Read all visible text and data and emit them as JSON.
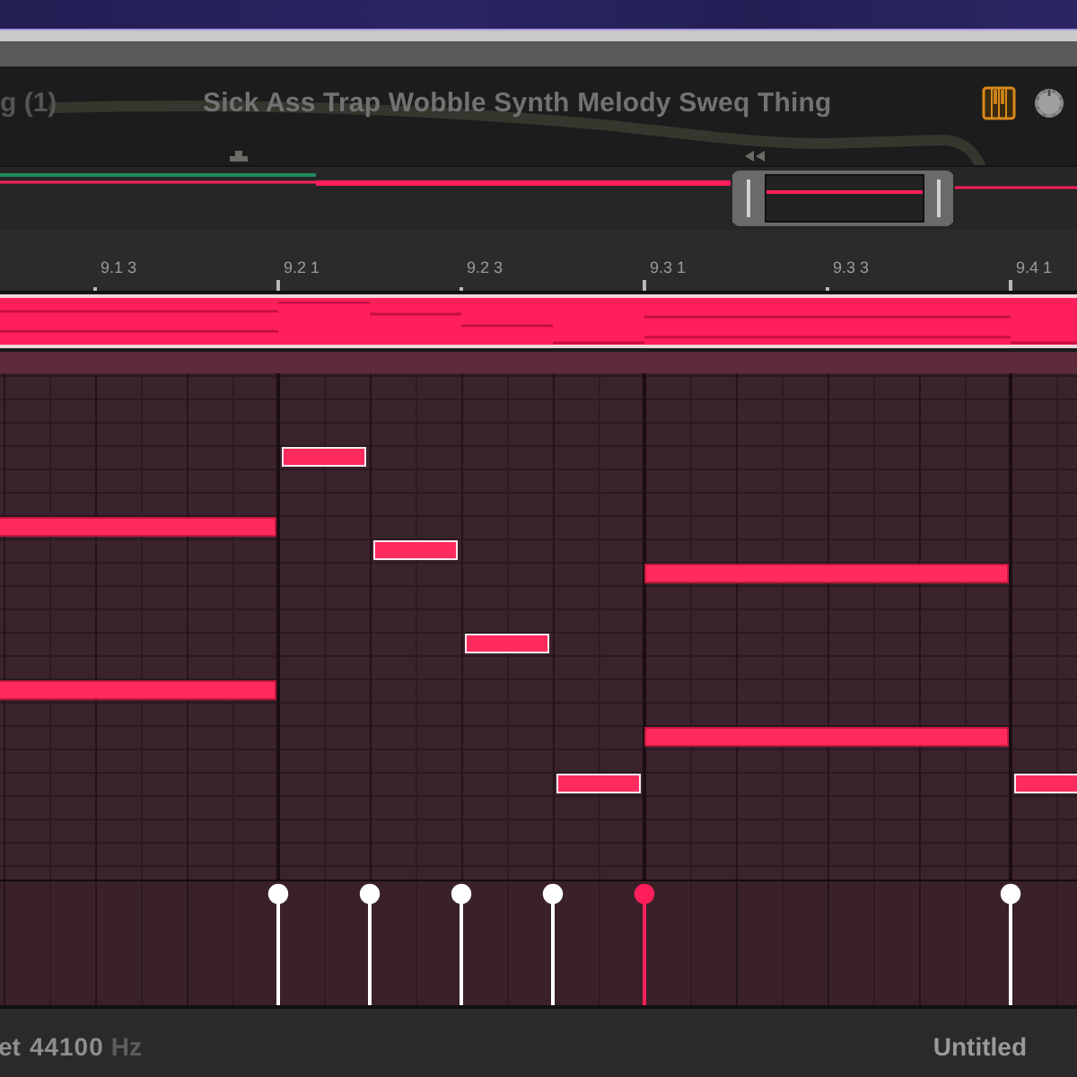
{
  "header": {
    "track_label": "g (1)",
    "title": "Sick Ass Trap Wobble Synth Melody Sweq Thing"
  },
  "ruler": {
    "labels": [
      "9.1 3",
      "9.2 1",
      "9.2 3",
      "9.3 1",
      "9.3 3",
      "9.4 1"
    ]
  },
  "notes": [
    {
      "selected": false
    },
    {
      "selected": false
    },
    {
      "selected": true
    },
    {
      "selected": true
    },
    {
      "selected": true
    },
    {
      "selected": true
    },
    {
      "selected": false
    },
    {
      "selected": false
    },
    {
      "selected": true
    }
  ],
  "velocities": [
    {
      "selected": true,
      "level": 1
    },
    {
      "selected": true,
      "level": 1
    },
    {
      "selected": true,
      "level": 1
    },
    {
      "selected": true,
      "level": 1
    },
    {
      "selected": false,
      "level": 1
    },
    {
      "selected": true,
      "level": 1
    }
  ],
  "status_bar": {
    "label": "et",
    "sample_rate": "44100",
    "unit": "Hz",
    "document": "Untitled"
  }
}
